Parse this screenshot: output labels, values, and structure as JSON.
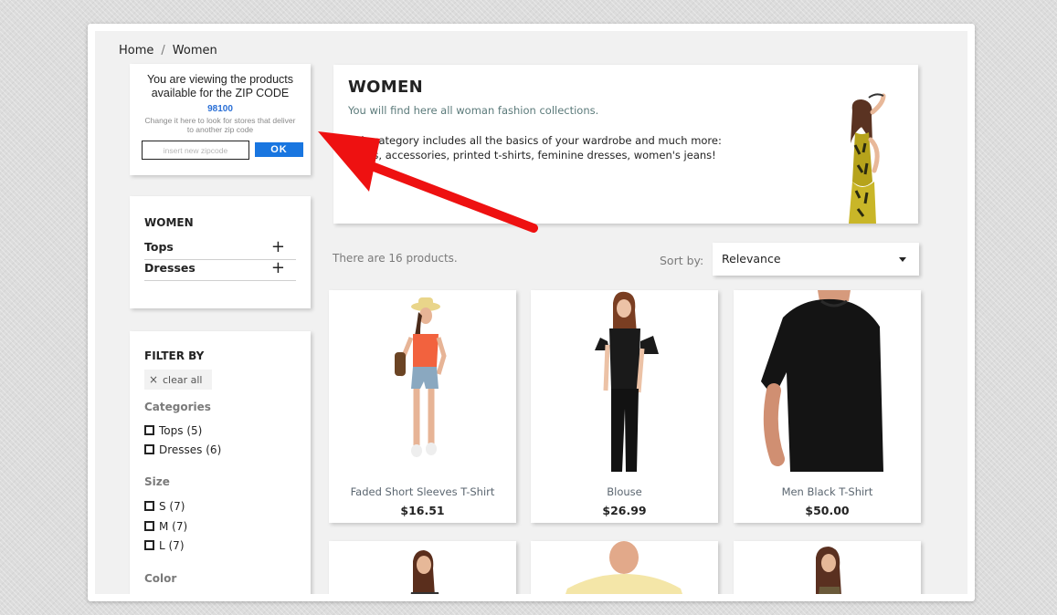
{
  "breadcrumb": {
    "home": "Home",
    "separator": "/",
    "current": "Women"
  },
  "zip_widget": {
    "message": "You are viewing the products available for the ZIP CODE",
    "zip_code": "98100",
    "hint": "Change it here to look for stores that deliver to another zip code",
    "input_placeholder": "insert new zipcode",
    "ok_label": "OK",
    "ok_color": "#1976e0"
  },
  "category_tree": {
    "title": "WOMEN",
    "items": [
      {
        "label": "Tops",
        "expand_icon": "+"
      },
      {
        "label": "Dresses",
        "expand_icon": "+"
      }
    ]
  },
  "filters": {
    "title": "FILTER BY",
    "clear_icon": "×",
    "clear_label": "clear all",
    "facets": [
      {
        "label": "Categories",
        "options": [
          "Tops (5)",
          "Dresses (6)"
        ]
      },
      {
        "label": "Size",
        "options": [
          "S (7)",
          "M (7)",
          "L (7)"
        ]
      },
      {
        "label": "Color",
        "options": []
      }
    ]
  },
  "banner": {
    "title": "WOMEN",
    "subtitle": "You will find here all woman fashion collections.",
    "description_line1": "This category includes all the basics of your wardrobe and much more:",
    "description_line2": "shoes, accessories, printed t-shirts, feminine dresses, women's jeans!"
  },
  "listing": {
    "count_text": "There are 16 products.",
    "sort_label": "Sort by:",
    "sort_value": "Relevance"
  },
  "products": [
    {
      "name": "Faded Short Sleeves T-Shirt",
      "price": "$16.51"
    },
    {
      "name": "Blouse",
      "price": "$26.99"
    },
    {
      "name": "Men Black T-Shirt",
      "price": "$50.00"
    }
  ],
  "annotation": {
    "arrow_color": "#ee1111"
  }
}
